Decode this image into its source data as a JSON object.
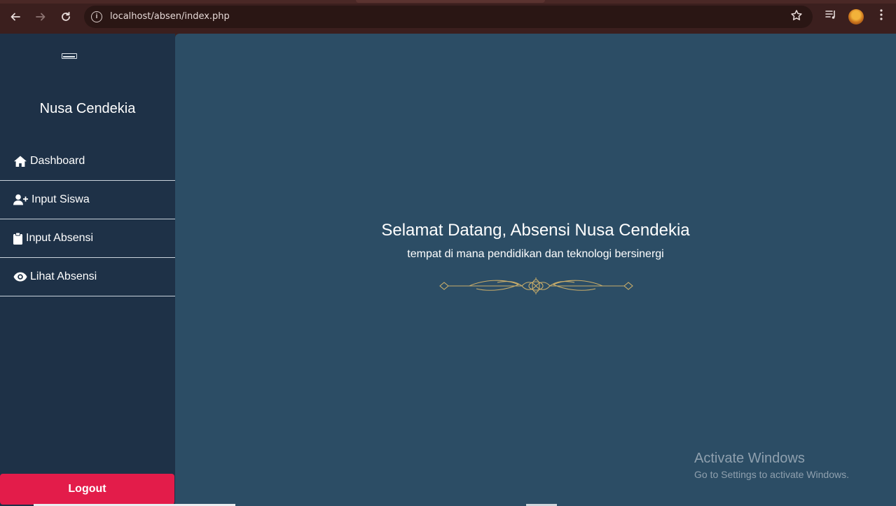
{
  "browser": {
    "url": "localhost/absen/index.php",
    "icons": {
      "back": "arrow-left",
      "forward": "arrow-right",
      "reload": "reload",
      "site_info": "info",
      "bookmark": "star",
      "media": "media-queue",
      "profile": "avatar",
      "menu": "kebab"
    }
  },
  "sidebar": {
    "brand": "Nusa Cendekia",
    "items": [
      {
        "label": "Dashboard",
        "icon": "home-icon"
      },
      {
        "label": "Input Siswa",
        "icon": "user-plus-icon"
      },
      {
        "label": "Input Absensi",
        "icon": "clipboard-icon"
      },
      {
        "label": "Lihat Absensi",
        "icon": "eye-icon"
      }
    ],
    "logout_label": "Logout"
  },
  "main": {
    "title": "Selamat Datang, Absensi Nusa Cendekia",
    "subtitle": "tempat di mana pendidikan dan teknologi bersinergi"
  },
  "watermark": {
    "line1": "Activate Windows",
    "line2": "Go to Settings to activate Windows."
  },
  "colors": {
    "sidebar_bg": "#1e3147",
    "main_bg": "#2c4d65",
    "logout_bg": "#e31c4a",
    "ornament": "#c9ad6a"
  }
}
